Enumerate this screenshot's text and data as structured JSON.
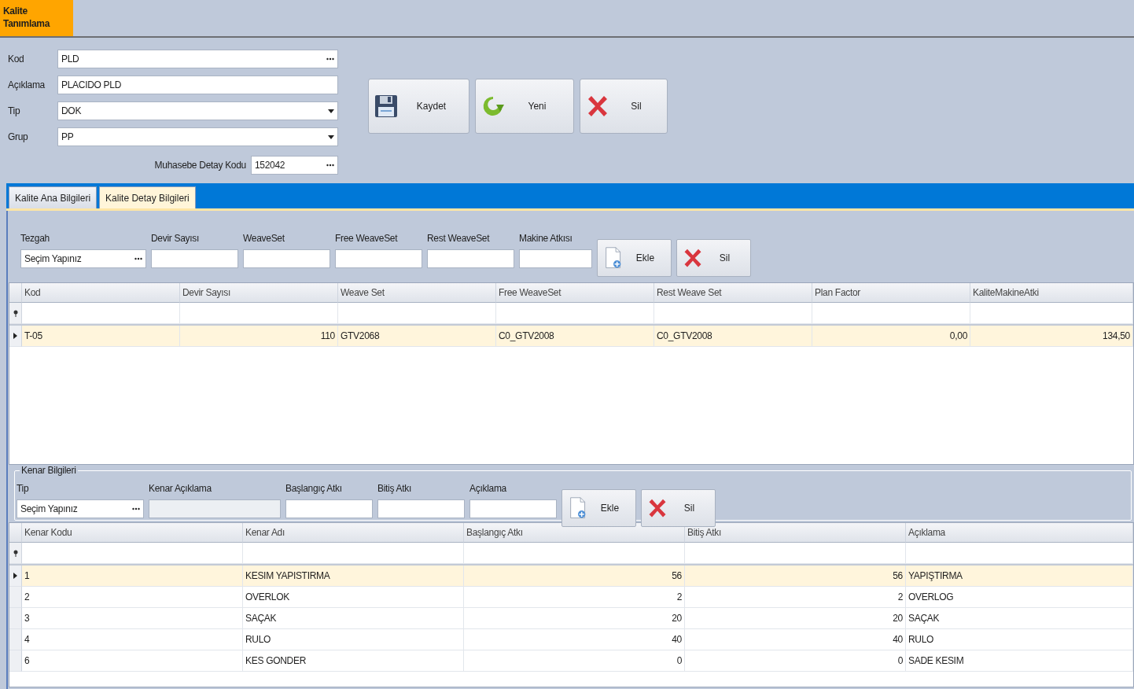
{
  "header_tab": {
    "title": "Kalite Tanımlama"
  },
  "form": {
    "fields": [
      {
        "label": "Kod",
        "value": "PLD",
        "kind": "lookup"
      },
      {
        "label": "Açıklama",
        "value": "PLACIDO PLD",
        "kind": "text"
      },
      {
        "label": "Tip",
        "value": "DOK",
        "kind": "dropdown"
      },
      {
        "label": "Grup",
        "value": "PP",
        "kind": "dropdown"
      }
    ],
    "account_field": {
      "label": "Muhasebe Detay Kodu",
      "value": "152042",
      "kind": "lookup"
    }
  },
  "actions": [
    {
      "label": "Kaydet",
      "kind": "save"
    },
    {
      "label": "Yeni",
      "kind": "new"
    },
    {
      "label": "Sil",
      "kind": "delete"
    }
  ],
  "tabs": [
    {
      "label": "Kalite Ana Bilgileri",
      "selected": false
    },
    {
      "label": "Kalite Detay Bilgileri",
      "selected": true
    }
  ],
  "detail_filter": {
    "fields": [
      {
        "label": "Tezgah",
        "value": "Seçim Yapınız",
        "kind": "lookup",
        "disabled": false
      },
      {
        "label": "Devir Sayısı",
        "kind": "text",
        "disabled": false
      },
      {
        "label": "WeaveSet",
        "kind": "text",
        "disabled": false
      },
      {
        "label": "Free WeaveSet",
        "kind": "text",
        "disabled": false
      },
      {
        "label": "Rest WeaveSet",
        "kind": "text",
        "disabled": false
      },
      {
        "label": "Makine Atkısı",
        "kind": "text",
        "disabled": false
      }
    ],
    "buttons": [
      {
        "label": "Ekle",
        "kind": "add"
      },
      {
        "label": "Sil",
        "kind": "delete"
      }
    ]
  },
  "detail_table": {
    "columns": [
      {
        "label": "Kod",
        "kind": "text"
      },
      {
        "label": "Devir Sayısı",
        "kind": "number"
      },
      {
        "label": "Weave Set",
        "kind": "text"
      },
      {
        "label": "Free WeaveSet",
        "kind": "text"
      },
      {
        "label": "Rest Weave Set",
        "kind": "text"
      },
      {
        "label": "Plan Factor",
        "kind": "number"
      },
      {
        "label": "KaliteMakineAtki",
        "kind": "number"
      }
    ],
    "rows": [
      {
        "cells": [
          "T-05",
          "110",
          "GTV2068",
          "C0_GTV2008",
          "C0_GTV2008",
          "0,00",
          "134,50"
        ],
        "selected": true
      }
    ]
  },
  "edge_group": {
    "title": "Kenar Bilgileri",
    "fields": [
      {
        "label": "Tip",
        "value": "Seçim Yapınız",
        "kind": "lookup",
        "disabled": false
      },
      {
        "label": "Kenar Açıklama",
        "kind": "text",
        "disabled": true
      },
      {
        "label": "Başlangıç Atkı",
        "kind": "text",
        "disabled": false
      },
      {
        "label": "Bitiş Atkı",
        "kind": "text",
        "disabled": false
      },
      {
        "label": "Açıklama",
        "kind": "text",
        "disabled": false
      }
    ],
    "buttons": [
      {
        "label": "Ekle",
        "kind": "add"
      },
      {
        "label": "Sil",
        "kind": "delete"
      }
    ]
  },
  "edge_table": {
    "columns": [
      {
        "label": "Kenar Kodu",
        "kind": "text"
      },
      {
        "label": "Kenar Adı",
        "kind": "text"
      },
      {
        "label": "Başlangıç Atkı",
        "kind": "number"
      },
      {
        "label": "Bitiş Atkı",
        "kind": "number"
      },
      {
        "label": "Açıklama",
        "kind": "text"
      }
    ],
    "rows": [
      {
        "cells": [
          "1",
          "KESIM YAPISTIRMA",
          "56",
          "56",
          "YAPIŞTIRMA"
        ],
        "selected": true
      },
      {
        "cells": [
          "2",
          "OVERLOK",
          "2",
          "2",
          "OVERLOG"
        ],
        "selected": false
      },
      {
        "cells": [
          "3",
          "SAÇAK",
          "20",
          "20",
          "SAÇAK"
        ],
        "selected": false
      },
      {
        "cells": [
          "4",
          "RULO",
          "40",
          "40",
          "RULO"
        ],
        "selected": false
      },
      {
        "cells": [
          "6",
          "KES GONDER",
          "0",
          "0",
          "SADE KESIM"
        ],
        "selected": false
      }
    ]
  }
}
